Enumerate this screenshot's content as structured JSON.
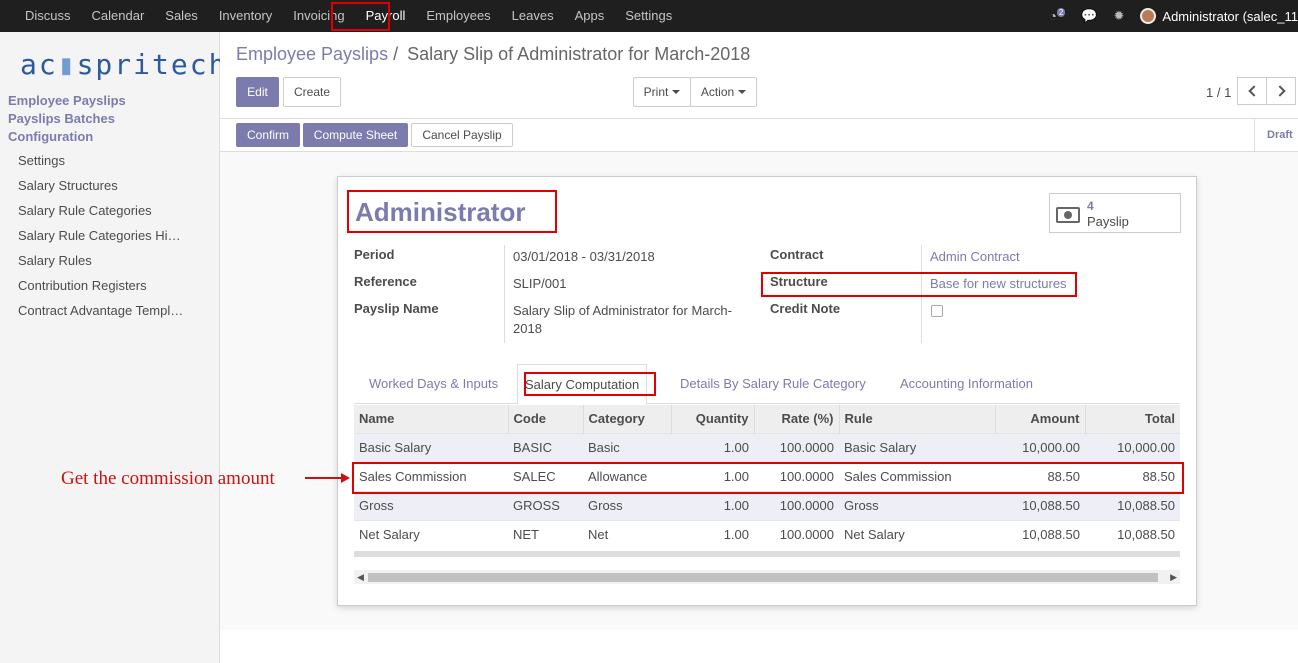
{
  "topbar": {
    "menu": [
      "Discuss",
      "Calendar",
      "Sales",
      "Inventory",
      "Invoicing",
      "Payroll",
      "Employees",
      "Leaves",
      "Apps",
      "Settings"
    ],
    "active": "Payroll",
    "messages_count": "2",
    "user": "Administrator (salec_11"
  },
  "sidebar": {
    "logo": "acspritech",
    "logo_left": "ac",
    "logo_right": "spritech",
    "headings": [
      "Employee Payslips",
      "Payslips Batches",
      "Configuration"
    ],
    "items": [
      "Settings",
      "Salary Structures",
      "Salary Rule Categories",
      "Salary Rule Categories Hi…",
      "Salary Rules",
      "Contribution Registers",
      "Contract Advantage Templ…"
    ]
  },
  "breadcrumb": {
    "parent": "Employee Payslips",
    "separator": "/",
    "current": "Salary Slip of Administrator for March-2018"
  },
  "toolbar": {
    "edit": "Edit",
    "create": "Create",
    "print": "Print",
    "action": "Action",
    "pager": "1 / 1"
  },
  "statusbar": {
    "confirm": "Confirm",
    "compute": "Compute Sheet",
    "cancel": "Cancel Payslip",
    "state": "Draft"
  },
  "form": {
    "employee": "Administrator",
    "smart_button": {
      "count": "4",
      "label": "Payslip"
    },
    "left_fields": [
      {
        "label": "Period",
        "value": "03/01/2018 - 03/31/2018"
      },
      {
        "label": "Reference",
        "value": "SLIP/001"
      },
      {
        "label": "Payslip Name",
        "value_line1": "Salary Slip of Administrator for March-",
        "value_line2": "2018"
      }
    ],
    "right_fields": [
      {
        "label": "Contract",
        "value": "Admin Contract"
      },
      {
        "label": "Structure",
        "value": "Base for new structures"
      },
      {
        "label": "Credit Note",
        "value": false
      }
    ]
  },
  "tabs": [
    "Worked Days & Inputs",
    "Salary Computation",
    "Details By Salary Rule Category",
    "Accounting Information"
  ],
  "active_tab": "Salary Computation",
  "table": {
    "headers": [
      "Name",
      "Code",
      "Category",
      "Quantity",
      "Rate (%)",
      "Rule",
      "Amount",
      "Total"
    ],
    "rows": [
      [
        "Basic Salary",
        "BASIC",
        "Basic",
        "1.00",
        "100.0000",
        "Basic Salary",
        "10,000.00",
        "10,000.00"
      ],
      [
        "Sales Commission",
        "SALEC",
        "Allowance",
        "1.00",
        "100.0000",
        "Sales Commission",
        "88.50",
        "88.50"
      ],
      [
        "Gross",
        "GROSS",
        "Gross",
        "1.00",
        "100.0000",
        "Gross",
        "10,088.50",
        "10,088.50"
      ],
      [
        "Net Salary",
        "NET",
        "Net",
        "1.00",
        "100.0000",
        "Net Salary",
        "10,088.50",
        "10,088.50"
      ]
    ]
  },
  "annotation": "Get the commission amount",
  "colors": {
    "accent": "#7c7bad",
    "highlight": "#e00000",
    "topbar": "#1f1f1f"
  }
}
